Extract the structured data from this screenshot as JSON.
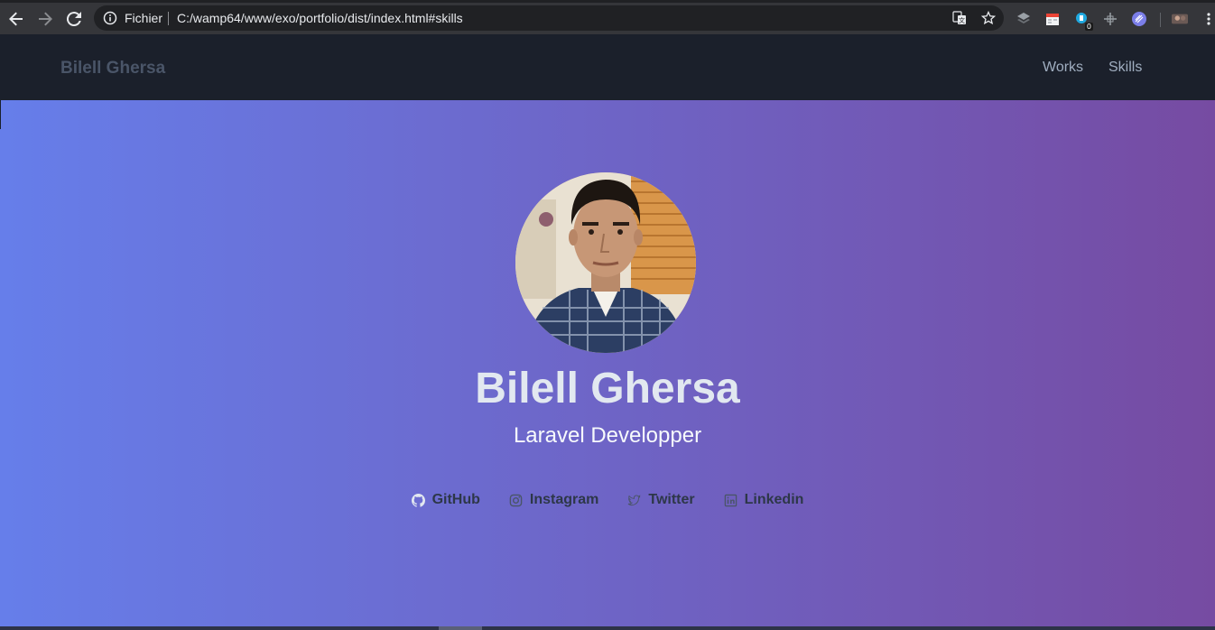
{
  "browser": {
    "scheme_label": "Fichier",
    "url": "C:/wamp64/www/exo/portfolio/dist/index.html#skills",
    "extension_badge": "0"
  },
  "navbar": {
    "brand": "Bilell Ghersa",
    "links": [
      "Works",
      "Skills"
    ]
  },
  "hero": {
    "name": "Bilell Ghersa",
    "role": "Laravel Developper",
    "socials": [
      {
        "label": "GitHub",
        "icon": "github-icon"
      },
      {
        "label": "Instagram",
        "icon": "instagram-icon"
      },
      {
        "label": "Twitter",
        "icon": "twitter-icon"
      },
      {
        "label": "Linkedin",
        "icon": "linkedin-icon"
      }
    ]
  },
  "colors": {
    "gradient_start": "#667eea",
    "gradient_end": "#764ba2",
    "navbar_bg": "#1b202b"
  }
}
